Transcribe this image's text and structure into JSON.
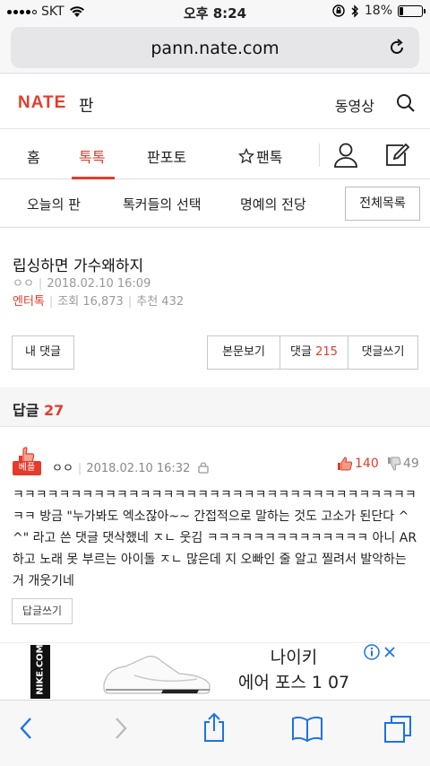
{
  "status_bar": {
    "carrier": "SKT",
    "time": "오후 8:24",
    "battery": "18%",
    "battery_level": 0.18
  },
  "browser": {
    "url": "pann.nate.com"
  },
  "header": {
    "logo": "NATE",
    "logo_sub": "판",
    "video": "동영상"
  },
  "tabs": [
    {
      "label": "홈"
    },
    {
      "label": "톡톡"
    },
    {
      "label": "판포토"
    },
    {
      "label": "팬톡"
    }
  ],
  "subnav": {
    "items": [
      {
        "label": "오늘의 판"
      },
      {
        "label": "톡커들의 선택"
      },
      {
        "label": "명예의 전당"
      }
    ],
    "all_list": "전체목록"
  },
  "article": {
    "title": "립싱하면 가수왜하지",
    "author": "ㅇㅇ",
    "date": "2018.02.10 16:09",
    "category": "엔터톡",
    "views_label": "조회",
    "views": "16,873",
    "recommend_label": "추천",
    "recommend": "432",
    "my_comments": "내 댓글",
    "view_body": "본문보기",
    "comments_label": "댓글",
    "comments_count": "215",
    "write_comment": "댓글쓰기"
  },
  "replies": {
    "title": "답글",
    "count": "27"
  },
  "comment": {
    "badge": "베플",
    "author": "ㅇㅇ",
    "date": "2018.02.10 16:32",
    "likes": "140",
    "dislikes": "49",
    "text": "ㅋㅋㅋㅋㅋㅋㅋㅋㅋㅋㅋㅋㅋㅋㅋㅋㅋㅋㅋㅋㅋㅋㅋㅋㅋㅋㅋㅋㅋㅋㅋㅋㅋㅋㅋㅋㅋ 방금 \"누가봐도 엑소잖아~~ 간접적으로 말하는 것도 고소가 된단다 ^^\" 라고 쓴 댓글 댓삭했네 ㅈㄴ 웃김 ㅋㅋㅋㅋㅋㅋㅋㅋㅋㅋㅋㅋㅋㅋ 아니 AR하고 노래 못 부르는 아이돌 ㅈㄴ 많은데 지 오빠인 줄 알고 찔려서 발악하는 거 개웃기네",
    "reply_button": "답글쓰기"
  },
  "ad": {
    "brand": "NIKE.COM",
    "line1": "나이키",
    "line2": "에어 포스 1 07"
  },
  "colors": {
    "accent": "#e53b2c",
    "link": "#1a73e8"
  }
}
